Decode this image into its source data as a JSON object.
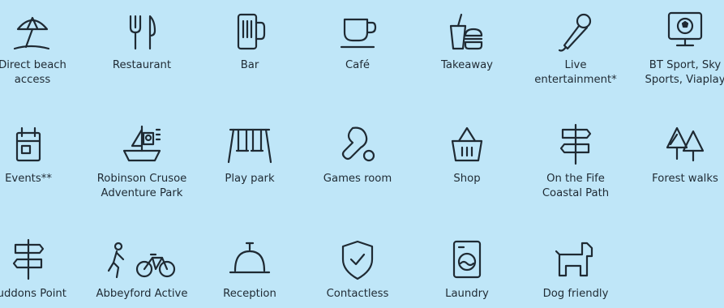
{
  "amenities": [
    {
      "label": "Direct beach\naccess",
      "icon": "beach-umbrella-icon"
    },
    {
      "label": "Restaurant",
      "icon": "cutlery-icon"
    },
    {
      "label": "Bar",
      "icon": "beer-glass-icon"
    },
    {
      "label": "Café",
      "icon": "coffee-cup-icon"
    },
    {
      "label": "Takeaway",
      "icon": "takeaway-icon"
    },
    {
      "label": "Live\nentertainment*",
      "icon": "microphone-icon"
    },
    {
      "label": "BT Sport, Sky\nSports, Viaplay",
      "icon": "tv-football-icon"
    },
    {
      "label": "Events**",
      "icon": "calendar-icon"
    },
    {
      "label": "Robinson Crusoe\nAdventure Park",
      "icon": "pirate-ship-icon"
    },
    {
      "label": "Play park",
      "icon": "swings-icon"
    },
    {
      "label": "Games room",
      "icon": "table-tennis-icon"
    },
    {
      "label": "Shop",
      "icon": "shopping-basket-icon"
    },
    {
      "label": "On the Fife\nCoastal Path",
      "icon": "signpost-icon"
    },
    {
      "label": "Forest walks",
      "icon": "trees-icon"
    },
    {
      "label": "Ruddons Point",
      "icon": "signpost-icon"
    },
    {
      "label": "Abbeyford Active",
      "icon": "walker-bicycle-icon"
    },
    {
      "label": "Reception",
      "icon": "reception-bell-icon"
    },
    {
      "label": "Contactless",
      "icon": "shield-check-icon"
    },
    {
      "label": "Laundry",
      "icon": "washing-machine-icon"
    },
    {
      "label": "Dog friendly",
      "icon": "dog-icon"
    }
  ]
}
